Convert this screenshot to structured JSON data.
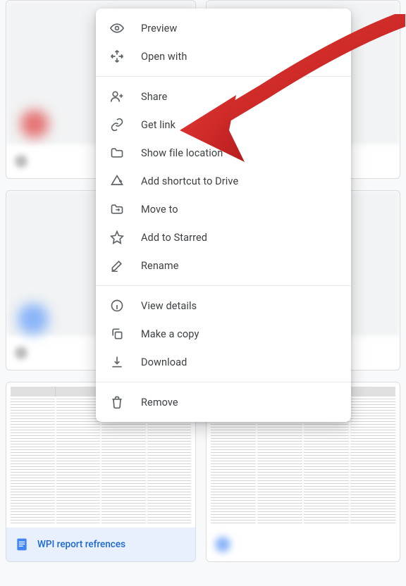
{
  "menu": {
    "preview": "Preview",
    "open_with": "Open with",
    "share": "Share",
    "get_link": "Get link",
    "show_file_location": "Show file location",
    "add_shortcut": "Add shortcut to Drive",
    "move_to": "Move to",
    "add_to_starred": "Add to Starred",
    "rename": "Rename",
    "view_details": "View details",
    "make_a_copy": "Make a copy",
    "download": "Download",
    "remove": "Remove"
  },
  "tiles": {
    "selected_title": "WPI report refrences"
  },
  "annotation": {
    "arrow_color": "#d32020"
  }
}
